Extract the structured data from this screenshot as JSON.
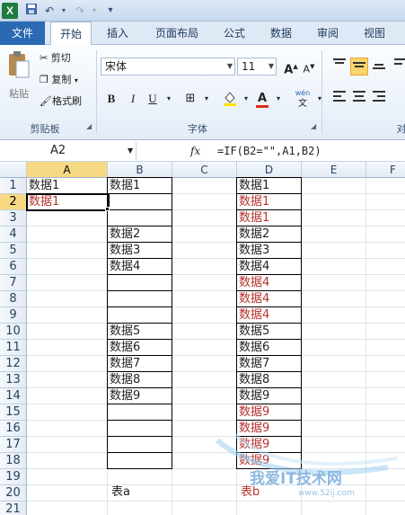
{
  "tabs": [
    {
      "label": "文件"
    },
    {
      "label": "开始"
    },
    {
      "label": "插入"
    },
    {
      "label": "页面布局"
    },
    {
      "label": "公式"
    },
    {
      "label": "数据"
    },
    {
      "label": "审阅"
    },
    {
      "label": "视图"
    }
  ],
  "ribbon": {
    "clipboard": {
      "paste": "粘贴",
      "cut": "剪切",
      "copy": "复制",
      "format_painter": "格式刷",
      "label": "剪贴板"
    },
    "font": {
      "name": "宋体",
      "size": "11",
      "label": "字体",
      "bold": "B",
      "italic": "I",
      "underline": "U",
      "grow": "A",
      "shrink": "A",
      "phonetic": "wén"
    },
    "alignment": {
      "label": "对"
    }
  },
  "formula_bar": {
    "name_box": "A2",
    "fx": "fx",
    "formula": "=IF(B2=\"\",A1,B2)"
  },
  "columns": [
    "A",
    "B",
    "C",
    "D",
    "E",
    "F"
  ],
  "rows": [
    "1",
    "2",
    "3",
    "4",
    "5",
    "6",
    "7",
    "8",
    "9",
    "10",
    "11",
    "12",
    "13",
    "14",
    "15",
    "16",
    "17",
    "18",
    "19",
    "20",
    "21"
  ],
  "col_a": [
    "数据1",
    "数据1"
  ],
  "col_b": [
    "数据1",
    "",
    "",
    "数据2",
    "数据3",
    "数据4",
    "",
    "",
    "",
    "数据5",
    "数据6",
    "数据7",
    "数据8",
    "数据9",
    "",
    "",
    "",
    ""
  ],
  "col_d": [
    "数据1",
    "数据1",
    "数据1",
    "数据2",
    "数据3",
    "数据4",
    "数据4",
    "数据4",
    "数据4",
    "数据5",
    "数据6",
    "数据7",
    "数据8",
    "数据9",
    "数据9",
    "数据9",
    "数据9",
    "数据9"
  ],
  "label_b20": "表a",
  "label_d20": "表b",
  "watermark": {
    "line1": "我爱IT技术网",
    "line2": "www.52ij.com"
  },
  "colors": {
    "red_text": "#b7312c",
    "file_tab": "#2a6ab3"
  }
}
